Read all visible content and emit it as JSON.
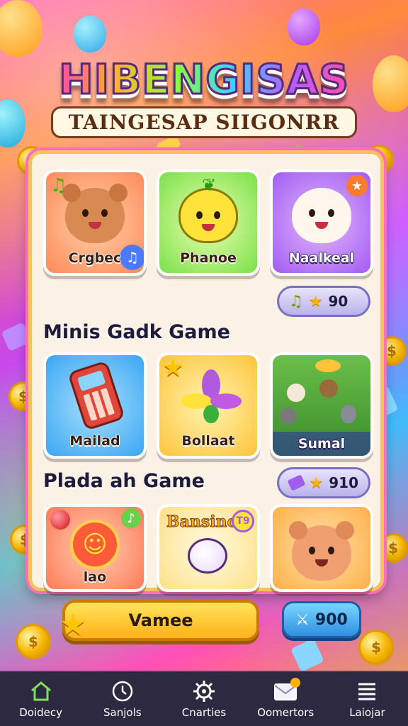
{
  "app": {
    "title": "HIBENGISAS",
    "subtitle": "TAINGESAP SIIGONRR"
  },
  "top_games": [
    {
      "label": "Crgbec",
      "color": "#ff8a5a"
    },
    {
      "label": "Phanoe",
      "color": "#7be04a"
    },
    {
      "label": "Naalkeal",
      "color": "#a35cf0"
    }
  ],
  "top_score": {
    "value": "90"
  },
  "section1": {
    "title": "Minis Gadk Game"
  },
  "mini_games": [
    {
      "label": "Mailad",
      "color": "#3aa6f2"
    },
    {
      "label": "Bollaat",
      "color": "#ffc43a"
    },
    {
      "label": "Sumal",
      "color": "#6a8fd8"
    }
  ],
  "section2": {
    "title": "Plada ah Game"
  },
  "section2_score": {
    "value": "910"
  },
  "bottom_games": [
    {
      "label": "lao",
      "color": "#ff7a5a"
    },
    {
      "label": "",
      "badge": "Bansino",
      "badge_num": "T9",
      "color": "#fff1c2"
    },
    {
      "label": "",
      "color": "#ffb04a"
    }
  ],
  "play_button": {
    "label": "Vamee"
  },
  "score_button": {
    "value": "900"
  },
  "bottom_nav": [
    {
      "label": "Doidecy",
      "icon": "home-icon"
    },
    {
      "label": "Sanjols",
      "icon": "clock-icon"
    },
    {
      "label": "Cnarties",
      "icon": "gear-icon"
    },
    {
      "label": "Oomertors",
      "icon": "mail-icon"
    },
    {
      "label": "Laiojar",
      "icon": "menu-icon"
    }
  ]
}
